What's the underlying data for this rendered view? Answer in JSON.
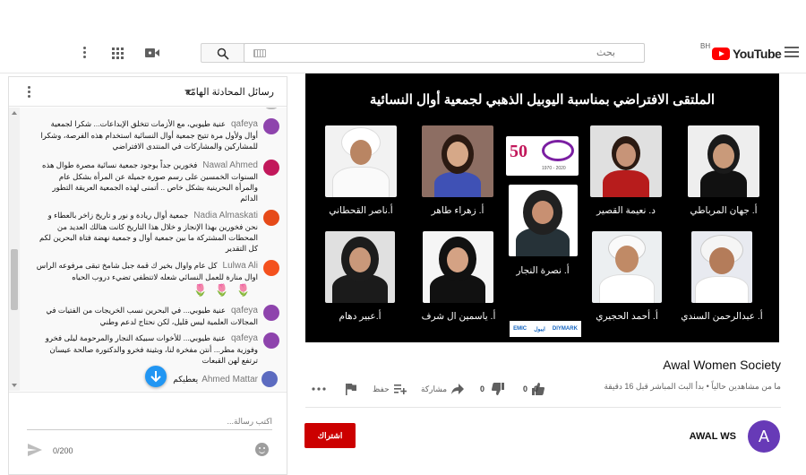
{
  "header": {
    "logo_text": "YouTube",
    "region": "BH",
    "search_placeholder": "بحث"
  },
  "chat": {
    "title": "رسائل المحادثة الهامّة",
    "messages": [
      {
        "author": "qafeya",
        "text": "عنية طيوبي، مع الأزمات تتخلق الإبداعات... شكرا لجمعية أوال ولأول مرة تتيح جمعية أوال النسائية استخدام هذه الفرصة، وشكرا للمشاركين والمشاركات في المنتدى الافتراضي",
        "avatar_color": "#8e44ad"
      },
      {
        "author": "Nawal Ahmed",
        "text": "فخورين جداً بوجود جمعية نسائية مصرة طوال هذه السنوات الخمسين على رسم صورة جميلة عن المرأة بشكل عام والمرأة البحرينية بشكل خاص .. أتمنى لهذه الجمعية العريقة التطور الدائم",
        "avatar_color": "#c2185b"
      },
      {
        "author": "Nadia Almaskati",
        "text": "جمعية أوال ريادة و نور و تاريخ زاخر بالعطاء و نحن فخورين بهذا الإنجاز و خلال هذا التاريخ كانت هنالك العديد من المحطات المشتركة ما بين جمعية أوال و جمعية نهضة فتاة البحرين لكم كل التقدير",
        "avatar_color": "#e64a19"
      },
      {
        "author": "Lulwa Ali",
        "text": "كل عام واوال بخير ك قمة جبل شامخ تبقى مرفوعه الراس اوال منارة للعمل النسائي شعله لاتنطفي تضيء دروب الحياه",
        "avatar_color": "#f4511e",
        "roses": "🌷🌷🌷"
      },
      {
        "author": "qafeya",
        "text": "عنية طيوبي... في البحرين نسب الخريجات من الفتيات في المجالات العلمية ليس قليل، لكن نحتاج لدعم وطني",
        "avatar_color": "#8e44ad"
      },
      {
        "author": "qafeya",
        "text": "عنية طيوبي... للأخوات سبيكة النجار والمرحومة ليلى فخرو وفوزية مطر... أنتن مفخرة لنا، وبثينة فخرو والدكتورة صالحة عيسان ترتفع لهن القبعات",
        "avatar_color": "#8e44ad"
      }
    ],
    "last_message": {
      "author": "Ahmed Mattar",
      "text": "يعطيكم",
      "avatar_color": "#5c6bc0"
    },
    "input_placeholder": "اكتب رسالة...",
    "char_count": "0/200"
  },
  "video": {
    "title": "الملتقى الافتراضي بمناسبة اليوبيل الذهبي لجمعية أوال النسائية",
    "speakers": [
      {
        "name": "أ. جهان المرباطي"
      },
      {
        "name": "د. نعيمة القصير"
      },
      {
        "name": "أ. زهراء طاهر"
      },
      {
        "name": "أ.ناصر القحطاني"
      },
      {
        "name": "أ. نصرة النجار"
      },
      {
        "name": "أ. عبدالرحمن السندي"
      },
      {
        "name": "أ. أحمد الحجيري"
      },
      {
        "name": "أ. ياسمين ال شرف"
      },
      {
        "name": "أ.عبير دهام"
      }
    ],
    "logo_number": "50",
    "logo_years": "1970 - 2020",
    "sponsors": [
      "EMIC",
      "ايبول",
      "DIYMARK"
    ]
  },
  "info": {
    "title": "Awal Women Society",
    "meta": "ما من مشاهدين حالياً • بدأ البث المباشر قبل 16 دقيقة",
    "like_count": "0",
    "dislike_count": "0",
    "share_label": "مشاركة",
    "save_label": "حفظ",
    "subscribe_label": "اشتراك",
    "channel_name": "AWAL WS",
    "channel_initial": "A"
  }
}
